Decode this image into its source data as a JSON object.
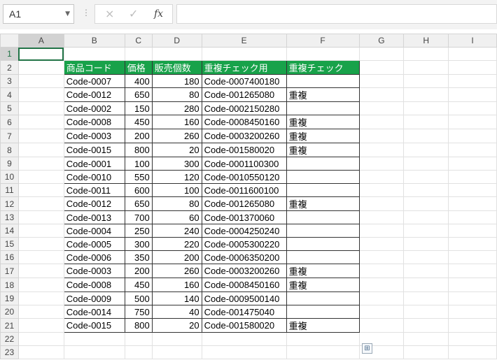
{
  "formula_bar": {
    "name_box": "A1",
    "cancel_icon": "×",
    "enter_icon": "✓",
    "fx_label": "fx",
    "formula": ""
  },
  "columns": [
    "A",
    "B",
    "C",
    "D",
    "E",
    "F",
    "G",
    "H",
    "I"
  ],
  "selected_cell": "A1",
  "header": [
    "商品コード",
    "価格",
    "販売個数",
    "重複チェック用",
    "重複チェック"
  ],
  "rows": [
    [
      "Code-0007",
      "400",
      "180",
      "Code-0007400180",
      ""
    ],
    [
      "Code-0012",
      "650",
      "80",
      "Code-001265080",
      "重複"
    ],
    [
      "Code-0002",
      "150",
      "280",
      "Code-0002150280",
      ""
    ],
    [
      "Code-0008",
      "450",
      "160",
      "Code-0008450160",
      "重複"
    ],
    [
      "Code-0003",
      "200",
      "260",
      "Code-0003200260",
      "重複"
    ],
    [
      "Code-0015",
      "800",
      "20",
      "Code-001580020",
      "重複"
    ],
    [
      "Code-0001",
      "100",
      "300",
      "Code-0001100300",
      ""
    ],
    [
      "Code-0010",
      "550",
      "120",
      "Code-0010550120",
      ""
    ],
    [
      "Code-0011",
      "600",
      "100",
      "Code-0011600100",
      ""
    ],
    [
      "Code-0012",
      "650",
      "80",
      "Code-001265080",
      "重複"
    ],
    [
      "Code-0013",
      "700",
      "60",
      "Code-001370060",
      ""
    ],
    [
      "Code-0004",
      "250",
      "240",
      "Code-0004250240",
      ""
    ],
    [
      "Code-0005",
      "300",
      "220",
      "Code-0005300220",
      ""
    ],
    [
      "Code-0006",
      "350",
      "200",
      "Code-0006350200",
      ""
    ],
    [
      "Code-0003",
      "200",
      "260",
      "Code-0003200260",
      "重複"
    ],
    [
      "Code-0008",
      "450",
      "160",
      "Code-0008450160",
      "重複"
    ],
    [
      "Code-0009",
      "500",
      "140",
      "Code-0009500140",
      ""
    ],
    [
      "Code-0014",
      "750",
      "40",
      "Code-001475040",
      ""
    ],
    [
      "Code-0015",
      "800",
      "20",
      "Code-001580020",
      "重複"
    ]
  ],
  "row_numbers": [
    "1",
    "2",
    "3",
    "4",
    "5",
    "6",
    "7",
    "8",
    "9",
    "10",
    "11",
    "12",
    "13",
    "14",
    "15",
    "16",
    "17",
    "18",
    "19",
    "20",
    "21",
    "22",
    "23"
  ],
  "quick_analysis_icon": "quick-analysis",
  "accent_color": "#217346",
  "header_fill": "#18a24a"
}
